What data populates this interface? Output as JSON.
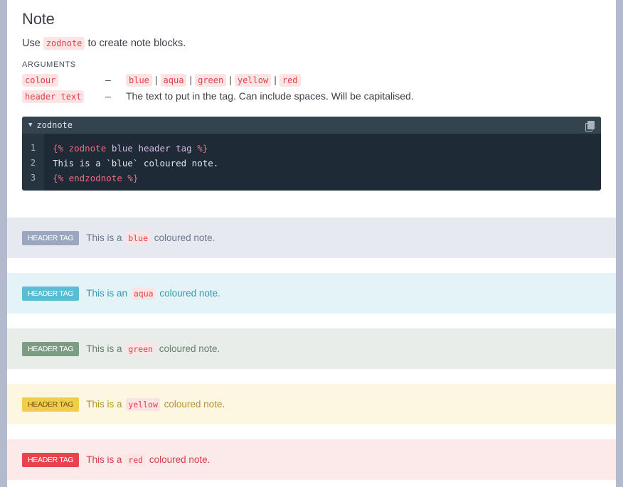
{
  "title": "Note",
  "intro": {
    "before": "Use",
    "code": "zodnote",
    "after": "to create note blocks."
  },
  "arguments": {
    "label": "ARGUMENTS",
    "colour": {
      "name": "colour",
      "dash": "–",
      "options": [
        "blue",
        "aqua",
        "green",
        "yellow",
        "red"
      ]
    },
    "header": {
      "name": "header text",
      "dash": "–",
      "desc": "The text to put in the tag. Can include spaces. Will be capitalised."
    }
  },
  "codeblock": {
    "title": "zodnote",
    "line_numbers": [
      "1",
      "2",
      "3"
    ],
    "line1": {
      "open": "{%",
      "kw": "zodnote",
      "args": "blue header tag",
      "close": "%}"
    },
    "line2": "This is a `blue` coloured note.",
    "line3": {
      "open": "{%",
      "kw": "endzodnote",
      "close": "%}"
    }
  },
  "notes": [
    {
      "tag": "HEADER TAG",
      "before": "This is a",
      "code": "blue",
      "after": "coloured note.",
      "bg": "#e6e9f0",
      "tag_bg": "#9aa7bf",
      "text": "#6b7891"
    },
    {
      "tag": "HEADER TAG",
      "before": "This is an",
      "code": "aqua",
      "after": "coloured note.",
      "bg": "#e3f3f8",
      "tag_bg": "#5bbcd6",
      "text": "#3d95ac"
    },
    {
      "tag": "HEADER TAG",
      "before": "This is a",
      "code": "green",
      "after": "coloured note.",
      "bg": "#e8ede9",
      "tag_bg": "#7d9c83",
      "text": "#66806a"
    },
    {
      "tag": "HEADER TAG",
      "before": "This is a",
      "code": "yellow",
      "after": "coloured note.",
      "bg": "#fdf6e0",
      "tag_bg": "#f2cc4b",
      "text": "#b7952a"
    },
    {
      "tag": "HEADER TAG",
      "before": "This is a",
      "code": "red",
      "after": "coloured note.",
      "bg": "#fce9ea",
      "tag_bg": "#e9434e",
      "text": "#d83c47"
    }
  ]
}
